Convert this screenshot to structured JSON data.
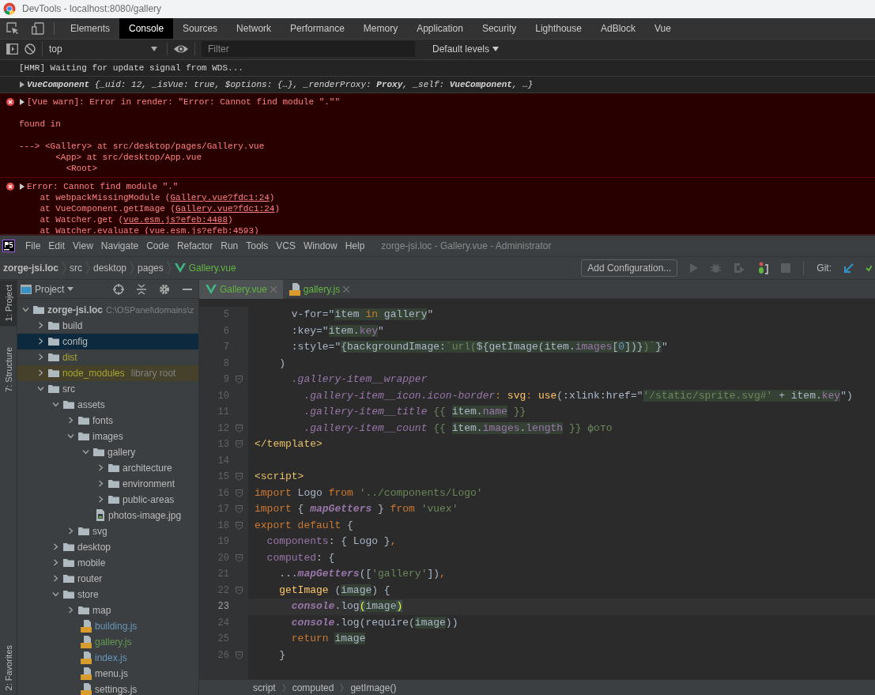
{
  "browser_window": {
    "title": "DevTools - localhost:8080/gallery"
  },
  "devtools": {
    "tabs": [
      {
        "label": "Elements",
        "selected": false
      },
      {
        "label": "Console",
        "selected": true
      },
      {
        "label": "Sources",
        "selected": false
      },
      {
        "label": "Network",
        "selected": false
      },
      {
        "label": "Performance",
        "selected": false
      },
      {
        "label": "Memory",
        "selected": false
      },
      {
        "label": "Application",
        "selected": false
      },
      {
        "label": "Security",
        "selected": false
      },
      {
        "label": "Lighthouse",
        "selected": false
      },
      {
        "label": "AdBlock",
        "selected": false
      },
      {
        "label": "Vue",
        "selected": false
      }
    ],
    "console_toolbar": {
      "context": "top",
      "filter_placeholder": "Filter",
      "levels": "Default levels"
    },
    "messages": [
      {
        "kind": "log",
        "text": "[HMR] Waiting for update signal from WDS..."
      },
      {
        "kind": "object",
        "expanded": false,
        "text": "**VueComponent** {_uid: 12, _isVue: true, $options: {…}, _renderProxy: **Proxy**, _self: **VueComponent**, …}"
      },
      {
        "kind": "error",
        "expanded": false,
        "paragraphs": [
          [
            "[Vue warn]: Error in render: \"Error: Cannot find module \".\"\""
          ],
          [
            "found in"
          ],
          [
            "---> <Gallery> at src/desktop/pages/Gallery.vue",
            "       <App> at src/desktop/App.vue",
            "         <Root>"
          ]
        ]
      },
      {
        "kind": "error",
        "expanded": false,
        "paragraphs": [
          [
            "Error: Cannot find module \".\""
          ]
        ],
        "stack": [
          {
            "text": "    at webpackMissingModule (",
            "link": "Gallery.vue?fdc1:24",
            "after": ")"
          },
          {
            "text": "    at VueComponent.getImage (",
            "link": "Gallery.vue?fdc1:24",
            "after": ")"
          },
          {
            "text": "    at Watcher.get (",
            "link": "vue.esm.js?efeb:4488",
            "after": ")"
          },
          {
            "text": "    at Watcher.evaluate (",
            "link": "vue.esm.js?efeb:4593",
            "after": ")"
          }
        ]
      }
    ]
  },
  "ide": {
    "menu": [
      "File",
      "Edit",
      "View",
      "Navigate",
      "Code",
      "Refactor",
      "Run",
      "Tools",
      "VCS",
      "Window",
      "Help"
    ],
    "title": "zorge-jsi.loc - Gallery.vue - Administrator",
    "breadcrumb": [
      {
        "text": "zorge-jsi.loc",
        "kind": "project"
      },
      {
        "text": "src",
        "kind": "folder"
      },
      {
        "text": "desktop",
        "kind": "folder"
      },
      {
        "text": "pages",
        "kind": "folder"
      },
      {
        "text": "Gallery.vue",
        "kind": "vue"
      }
    ],
    "run_config": "Add Configuration...",
    "git_label": "Git:",
    "side_tools_top": [
      {
        "label": "1: Project",
        "selected": true
      },
      {
        "label": "7: Structure",
        "selected": false
      }
    ],
    "side_tools_bottom": [
      {
        "label": "2: Favorites",
        "selected": false
      }
    ],
    "project_panel": {
      "title": "Project",
      "tree": [
        {
          "name": "zorge-jsi.loc",
          "kind": "project",
          "path": "C:\\OSPanel\\domains\\z",
          "expanded": true,
          "selected": false,
          "children": [
            {
              "name": "build",
              "kind": "folder",
              "expanded": false,
              "selected": false
            },
            {
              "name": "config",
              "kind": "folder",
              "expanded": false,
              "selected": true
            },
            {
              "name": "dist",
              "kind": "folder",
              "expanded": false,
              "selected": false,
              "color": "#a6a630"
            },
            {
              "name": "node_modules",
              "kind": "folder",
              "expanded": false,
              "selected": false,
              "color": "#a6a630",
              "note": "library root"
            },
            {
              "name": "src",
              "kind": "folder",
              "expanded": true,
              "selected": false,
              "children": [
                {
                  "name": "assets",
                  "kind": "folder",
                  "expanded": true,
                  "selected": false,
                  "children": [
                    {
                      "name": "fonts",
                      "kind": "folder",
                      "expanded": false,
                      "selected": false
                    },
                    {
                      "name": "images",
                      "kind": "folder",
                      "expanded": true,
                      "selected": false,
                      "children": [
                        {
                          "name": "gallery",
                          "kind": "folder",
                          "expanded": true,
                          "selected": false,
                          "children": [
                            {
                              "name": "architecture",
                              "kind": "folder",
                              "expanded": false,
                              "selected": false
                            },
                            {
                              "name": "environment",
                              "kind": "folder",
                              "expanded": false,
                              "selected": false
                            },
                            {
                              "name": "public-areas",
                              "kind": "folder",
                              "expanded": false,
                              "selected": false
                            }
                          ]
                        },
                        {
                          "name": "photos-image.jpg",
                          "kind": "image",
                          "selected": false
                        }
                      ]
                    },
                    {
                      "name": "svg",
                      "kind": "folder",
                      "expanded": false,
                      "selected": false
                    }
                  ]
                },
                {
                  "name": "desktop",
                  "kind": "folder",
                  "expanded": false,
                  "selected": false
                },
                {
                  "name": "mobile",
                  "kind": "folder",
                  "expanded": false,
                  "selected": false
                },
                {
                  "name": "router",
                  "kind": "folder",
                  "expanded": false,
                  "selected": false
                },
                {
                  "name": "store",
                  "kind": "folder",
                  "expanded": true,
                  "selected": false,
                  "children": [
                    {
                      "name": "map",
                      "kind": "folder",
                      "expanded": false,
                      "selected": false
                    },
                    {
                      "name": "building.js",
                      "kind": "js",
                      "selected": false,
                      "color": "#6897bb"
                    },
                    {
                      "name": "gallery.js",
                      "kind": "js",
                      "selected": false,
                      "color": "#629755"
                    },
                    {
                      "name": "index.js",
                      "kind": "js",
                      "selected": false,
                      "color": "#6897bb"
                    },
                    {
                      "name": "menu.js",
                      "kind": "js",
                      "selected": false
                    },
                    {
                      "name": "settings.js",
                      "kind": "js",
                      "selected": false
                    }
                  ]
                }
              ]
            }
          ]
        }
      ]
    },
    "editor": {
      "tabs": [
        {
          "label": "Gallery.vue",
          "kind": "vue",
          "selected": true
        },
        {
          "label": "gallery.js",
          "kind": "js",
          "selected": false
        }
      ],
      "lines": [
        {
          "number": "5",
          "current": false,
          "fold": false,
          "tokens": [
            {
              "text": "      v-for=\"",
              "kind": "plain"
            },
            {
              "text": "item ",
              "kind": "inj"
            },
            {
              "text": "in",
              "kind": "injkw"
            },
            {
              "text": " gallery",
              "kind": "inj"
            },
            {
              "text": "\"",
              "kind": "plain"
            }
          ]
        },
        {
          "number": "6",
          "current": false,
          "fold": false,
          "tokens": [
            {
              "text": "      :key=\"",
              "kind": "plain"
            },
            {
              "text": "item.",
              "kind": "inj"
            },
            {
              "text": "key",
              "kind": "injprop"
            },
            {
              "text": "\"",
              "kind": "plain"
            }
          ]
        },
        {
          "number": "7",
          "current": false,
          "fold": false,
          "tokens": [
            {
              "text": "      :style=\"",
              "kind": "plain"
            },
            {
              "text": "{backgroundImage:",
              "kind": "inj"
            },
            {
              "text": "`url(",
              "kind": "injstr"
            },
            {
              "text": "${getImage(item.",
              "kind": "inj"
            },
            {
              "text": "images",
              "kind": "injprop"
            },
            {
              "text": "[",
              "kind": "inj"
            },
            {
              "text": "0",
              "kind": "injnum"
            },
            {
              "text": "])}",
              "kind": "inj"
            },
            {
              "text": ")`",
              "kind": "injstr"
            },
            {
              "text": "}",
              "kind": "inj"
            },
            {
              "text": "\"",
              "kind": "plain"
            }
          ]
        },
        {
          "number": "8",
          "current": false,
          "fold": false,
          "tokens": [
            {
              "text": "    )",
              "kind": "plain"
            }
          ]
        },
        {
          "number": "9",
          "current": false,
          "fold": true,
          "tokens": [
            {
              "text": "      .gallery-item__wrapper",
              "kind": "selector"
            }
          ]
        },
        {
          "number": "10",
          "current": false,
          "fold": false,
          "tokens": [
            {
              "text": "        .gallery-item__icon.icon-border",
              "kind": "selector"
            },
            {
              "text": ": ",
              "kind": "keyword"
            },
            {
              "text": "svg",
              "kind": "function"
            },
            {
              "text": ": ",
              "kind": "keyword"
            },
            {
              "text": "use",
              "kind": "function"
            },
            {
              "text": "(:xlink:href=\"",
              "kind": "plain"
            },
            {
              "text": "'/static/sprite.svg#'",
              "kind": "injstr"
            },
            {
              "text": " + item.",
              "kind": "inj"
            },
            {
              "text": "key",
              "kind": "injprop"
            },
            {
              "text": "\")",
              "kind": "plain"
            }
          ]
        },
        {
          "number": "11",
          "current": false,
          "fold": false,
          "tokens": [
            {
              "text": "        .gallery-item__title",
              "kind": "selector"
            },
            {
              "text": " {{ ",
              "kind": "string"
            },
            {
              "text": "item.",
              "kind": "inj"
            },
            {
              "text": "name",
              "kind": "injprop"
            },
            {
              "text": " }}",
              "kind": "string"
            }
          ]
        },
        {
          "number": "12",
          "current": false,
          "fold": true,
          "tokens": [
            {
              "text": "        .gallery-item__count",
              "kind": "selector"
            },
            {
              "text": " {{ ",
              "kind": "string"
            },
            {
              "text": "item.",
              "kind": "inj"
            },
            {
              "text": "images",
              "kind": "injprop"
            },
            {
              "text": ".",
              "kind": "inj"
            },
            {
              "text": "length",
              "kind": "injprop"
            },
            {
              "text": " }} фото",
              "kind": "string"
            }
          ]
        },
        {
          "number": "13",
          "current": false,
          "fold": true,
          "tokens": [
            {
              "text": "</template>",
              "kind": "tag"
            }
          ]
        },
        {
          "number": "14",
          "current": false,
          "fold": false
        },
        {
          "number": "15",
          "current": false,
          "fold": true,
          "tokens": [
            {
              "text": "<script>",
              "kind": "tag"
            }
          ]
        },
        {
          "number": "16",
          "current": false,
          "fold": true,
          "tokens": [
            {
              "text": "import",
              "kind": "keyword"
            },
            {
              "text": " Logo ",
              "kind": "plain"
            },
            {
              "text": "from",
              "kind": "keyword"
            },
            {
              "text": " '../components/Logo'",
              "kind": "string"
            }
          ]
        },
        {
          "number": "17",
          "current": false,
          "fold": true,
          "tokens": [
            {
              "text": "import",
              "kind": "keyword"
            },
            {
              "text": " { ",
              "kind": "plain"
            },
            {
              "text": "mapGetters",
              "kind": "call"
            },
            {
              "text": " } ",
              "kind": "plain"
            },
            {
              "text": "from",
              "kind": "keyword"
            },
            {
              "text": " 'vuex'",
              "kind": "string"
            }
          ]
        },
        {
          "number": "18",
          "current": false,
          "fold": true,
          "tokens": [
            {
              "text": "export default",
              "kind": "keyword"
            },
            {
              "text": " {",
              "kind": "plain"
            }
          ]
        },
        {
          "number": "19",
          "current": false,
          "fold": false,
          "tokens": [
            {
              "text": "  components",
              "kind": "property"
            },
            {
              "text": ": { Logo }",
              "kind": "plain"
            },
            {
              "text": ",",
              "kind": "keyword"
            }
          ]
        },
        {
          "number": "20",
          "current": false,
          "fold": true,
          "tokens": [
            {
              "text": "  computed",
              "kind": "property"
            },
            {
              "text": ": {",
              "kind": "plain"
            }
          ]
        },
        {
          "number": "21",
          "current": false,
          "fold": false,
          "tokens": [
            {
              "text": "    ...",
              "kind": "plain"
            },
            {
              "text": "mapGetters",
              "kind": "call"
            },
            {
              "text": "([",
              "kind": "plain"
            },
            {
              "text": "'gallery'",
              "kind": "string"
            },
            {
              "text": "])",
              "kind": "plain"
            },
            {
              "text": ",",
              "kind": "keyword"
            }
          ]
        },
        {
          "number": "22",
          "current": false,
          "fold": true,
          "tokens": [
            {
              "text": "    getImage",
              "kind": "function"
            },
            {
              "text": " (",
              "kind": "plain"
            },
            {
              "text": "image",
              "kind": "inj"
            },
            {
              "text": ") {",
              "kind": "plain"
            }
          ]
        },
        {
          "number": "23",
          "current": true,
          "fold": false,
          "tokens": [
            {
              "text": "      console",
              "kind": "call"
            },
            {
              "text": ".log",
              "kind": "plain"
            },
            {
              "text": "(",
              "kind": "brace"
            },
            {
              "text": "image",
              "kind": "inj"
            },
            {
              "text": ")",
              "kind": "brace"
            }
          ]
        },
        {
          "number": "24",
          "current": false,
          "fold": false,
          "tokens": [
            {
              "text": "      console",
              "kind": "call"
            },
            {
              "text": ".log(require(",
              "kind": "plain"
            },
            {
              "text": "image",
              "kind": "inj"
            },
            {
              "text": "))",
              "kind": "plain"
            }
          ]
        },
        {
          "number": "25",
          "current": false,
          "fold": false,
          "tokens": [
            {
              "text": "      return ",
              "kind": "keyword"
            },
            {
              "text": "image",
              "kind": "inj"
            }
          ]
        },
        {
          "number": "26",
          "current": false,
          "fold": true,
          "tokens": [
            {
              "text": "    }",
              "kind": "plain"
            }
          ]
        }
      ],
      "breadcrumb": [
        "script",
        "computed",
        "getImage()"
      ]
    }
  }
}
